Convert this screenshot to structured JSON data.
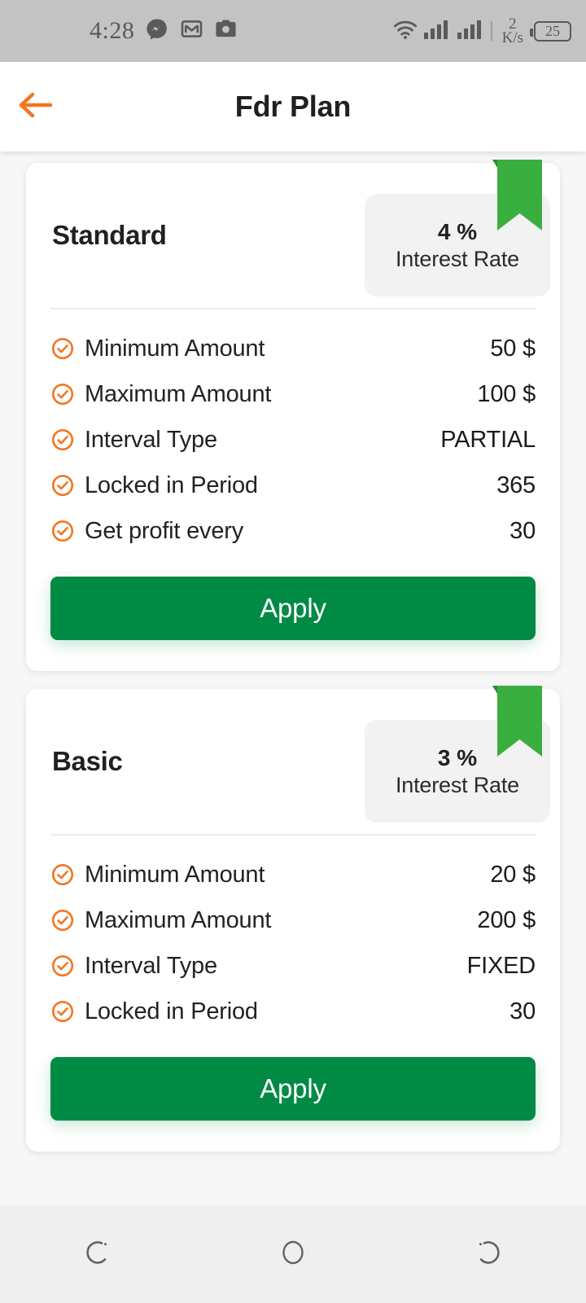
{
  "status_bar": {
    "time": "4:28",
    "left_icons": [
      "messenger-icon",
      "gmail-icon",
      "camera-icon"
    ],
    "wifi_icon": "wifi-icon",
    "signal_icons": [
      "signal-bars-icon",
      "signal-bars-icon"
    ],
    "net_speed_value": "2",
    "net_speed_unit": "K/s",
    "battery_level": "25",
    "background_color": "#c3c3c3"
  },
  "appbar": {
    "back_icon": "arrow-left-icon",
    "title": "Fdr Plan",
    "accent_color": "#f57523"
  },
  "theme": {
    "accent_orange": "#f57523",
    "ribbon_green": "#3aaf3f",
    "button_green": "#018a44",
    "page_background": "#f7f7f7",
    "badge_background": "#f2f2f2"
  },
  "plans": [
    {
      "name": "Standard",
      "rate_percent": "4 %",
      "rate_label": "Interest Rate",
      "ribbon": "bookmark-ribbon",
      "rows": [
        {
          "label": "Minimum Amount",
          "value": "50 $"
        },
        {
          "label": "Maximum Amount",
          "value": "100 $"
        },
        {
          "label": "Interval Type",
          "value": "PARTIAL"
        },
        {
          "label": "Locked in Period",
          "value": "365"
        },
        {
          "label": "Get profit every",
          "value": "30"
        }
      ],
      "apply_label": "Apply"
    },
    {
      "name": "Basic",
      "rate_percent": "3 %",
      "rate_label": "Interest Rate",
      "ribbon": "bookmark-ribbon",
      "rows": [
        {
          "label": "Minimum Amount",
          "value": "20 $"
        },
        {
          "label": "Maximum Amount",
          "value": "200 $"
        },
        {
          "label": "Interval Type",
          "value": "FIXED"
        },
        {
          "label": "Locked in Period",
          "value": "30"
        }
      ],
      "apply_label": "Apply"
    }
  ],
  "navbar": {
    "recents_icon": "recents-icon",
    "home_icon": "home-circle-icon",
    "back_icon": "back-gesture-icon",
    "background_color": "#efefef"
  }
}
